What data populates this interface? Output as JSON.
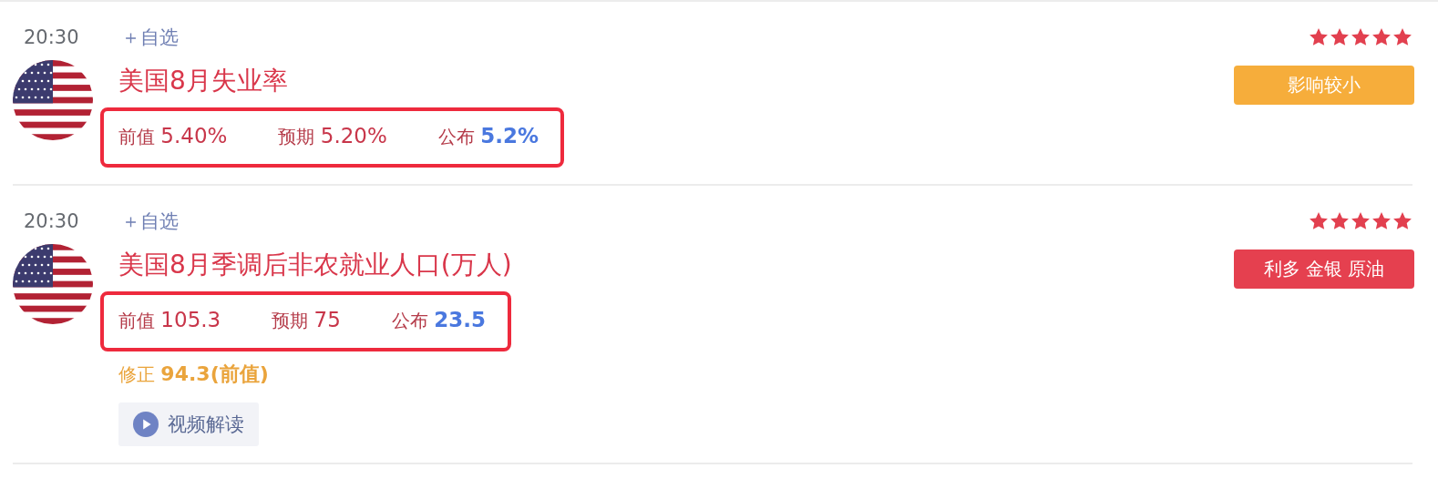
{
  "events": [
    {
      "time": "20:30",
      "watch": "＋自选",
      "stars": 5,
      "title": "美国8月失业率",
      "highlighted": true,
      "values": [
        {
          "label": "前值",
          "value": "5.40%",
          "kind": "previous"
        },
        {
          "label": "预期",
          "value": "5.20%",
          "kind": "forecast"
        },
        {
          "label": "公布",
          "value": "5.2%",
          "kind": "actual"
        }
      ],
      "tag": {
        "text": "影响较小",
        "color": "#f6ad3b"
      }
    },
    {
      "time": "20:30",
      "watch": "＋自选",
      "stars": 5,
      "title": "美国8月季调后非农就业人口(万人)",
      "highlighted": true,
      "values": [
        {
          "label": "前值",
          "value": "105.3",
          "kind": "previous"
        },
        {
          "label": "预期",
          "value": "75",
          "kind": "forecast"
        },
        {
          "label": "公布",
          "value": "23.5",
          "kind": "actual"
        }
      ],
      "tag": {
        "text": "利多 金银 原油",
        "color": "#e5404f"
      },
      "revision": {
        "label": "修正",
        "value": "94.3(前值)"
      },
      "video": "视频解读"
    }
  ]
}
